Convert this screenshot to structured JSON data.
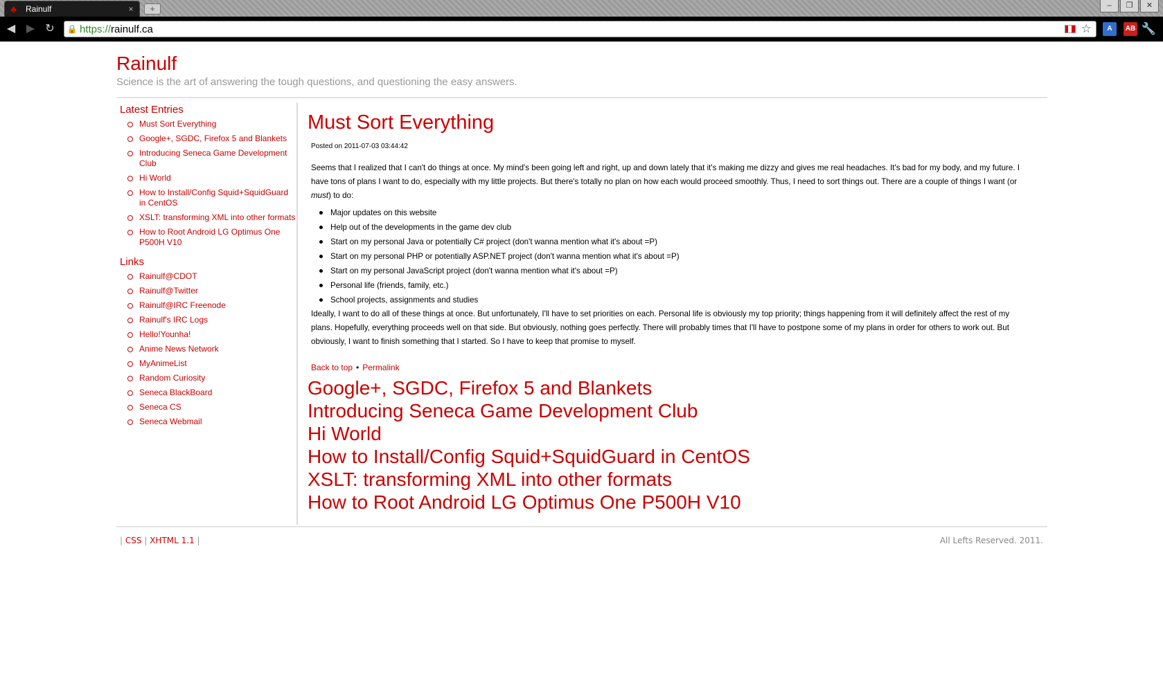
{
  "browser": {
    "tab_title": "Rainulf",
    "tab_close": "×",
    "new_tab": "+",
    "url_scheme": "https://",
    "url_host": "rainulf.ca",
    "window_buttons": [
      "–",
      "❐",
      "✕"
    ],
    "ext_translate": "A",
    "ext_adblock": "AB"
  },
  "site": {
    "title": "Rainulf",
    "tagline": "Science is the art of answering the tough questions, and questioning the easy answers."
  },
  "sidebar": {
    "latest_heading": "Latest Entries",
    "latest": [
      "Must Sort Everything",
      "Google+, SGDC, Firefox 5 and Blankets",
      "Introducing Seneca Game Development Club",
      "Hi World",
      "How to Install/Config Squid+SquidGuard in CentOS",
      "XSLT: transforming XML into other formats",
      "How to Root Android LG Optimus One P500H V10"
    ],
    "links_heading": "Links",
    "links": [
      "Rainulf@CDOT",
      "Rainulf@Twitter",
      "Rainulf@IRC Freenode",
      "Rainulf's IRC Logs",
      "Hello!Younha!",
      "Anime News Network",
      "MyAnimeList",
      "Random Curiosity",
      "Seneca BlackBoard",
      "Seneca CS",
      "Seneca Webmail"
    ]
  },
  "post": {
    "title": "Must Sort Everything",
    "meta": "Posted on 2011-07-03 03:44:42",
    "para1_a": "Seems that I realized that I can't do things at once. My mind's been going left and right, up and down lately that it's making me dizzy and gives me real headaches. It's bad for my body, and my future. I have tons of plans I want to do, especially with my little projects. But there's totally no plan on how each would proceed smoothly. Thus, I need to sort things out. There are a couple of things I want (or ",
    "para1_em": "must",
    "para1_b": ") to do:",
    "items": [
      "Major updates on this website",
      "Help out of the developments in the game dev club",
      "Start on my personal Java or potentially C# project (don't wanna mention what it's about =P)",
      "Start on my personal PHP or potentially ASP.NET project (don't wanna mention what it's about =P)",
      "Start on my personal JavaScript project (don't wanna mention what it's about =P)",
      "Personal life (friends, family, etc.)",
      "School projects, assignments and studies"
    ],
    "para2": "Ideally, I want to do all of these things at once. But unfortunately, I'll have to set priorities on each. Personal life is obviously my top priority; things happening from it will definitely affect the rest of my plans. Hopefully, everything proceeds well on that side. But obviously, nothing goes perfectly. There will probably times that I'll have to postpone some of my plans in order for others to work out. But obviously, I want to finish something that I started. So I have to keep that promise to myself.",
    "back_to_top": "Back to top",
    "separator": "•",
    "permalink": "Permalink"
  },
  "older_posts": [
    "Google+, SGDC, Firefox 5 and Blankets",
    "Introducing Seneca Game Development Club",
    "Hi World",
    "How to Install/Config Squid+SquidGuard in CentOS",
    "XSLT: transforming XML into other formats",
    "How to Root Android LG Optimus One P500H V10"
  ],
  "footer": {
    "pipe": "|",
    "css": "CSS",
    "xhtml": "XHTML 1.1",
    "copyright": "All Lefts Reserved. 2011."
  },
  "colors": {
    "accent": "#cc0000",
    "muted": "#999999",
    "rule": "#e3e3e3"
  }
}
